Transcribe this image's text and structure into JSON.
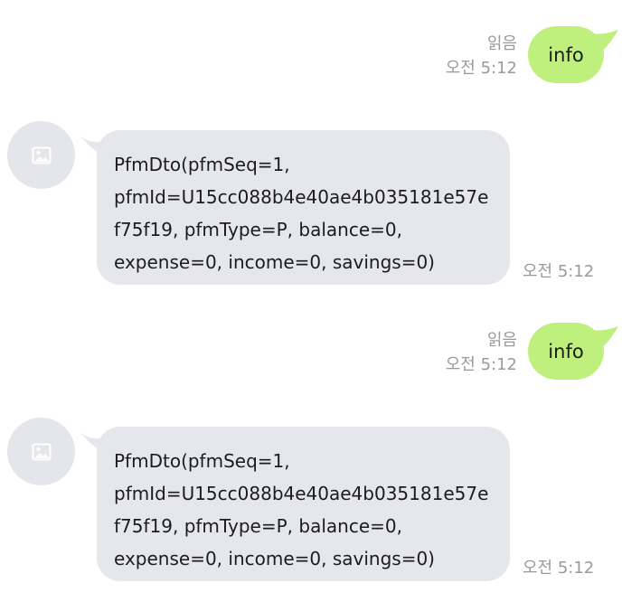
{
  "colors": {
    "sent_bubble": "#bff07d",
    "received_bubble": "#e5e7eb",
    "meta_text": "#9a9a9a"
  },
  "messages": [
    {
      "direction": "outgoing",
      "text": "info",
      "read_label": "읽음",
      "time": "오전 5:12"
    },
    {
      "direction": "incoming",
      "avatar_icon": "image-placeholder-icon",
      "lines": [
        "PfmDto(pfmSeq=1,",
        "pfmId=U15cc088b4e40ae4b035181e57e",
        "f75f19, pfmType=P, balance=0,",
        "expense=0, income=0, savings=0)"
      ],
      "time": "오전 5:12"
    },
    {
      "direction": "outgoing",
      "text": "info",
      "read_label": "읽음",
      "time": "오전 5:12"
    },
    {
      "direction": "incoming",
      "avatar_icon": "image-placeholder-icon",
      "lines": [
        "PfmDto(pfmSeq=1,",
        "pfmId=U15cc088b4e40ae4b035181e57e",
        "f75f19, pfmType=P, balance=0,",
        "expense=0, income=0, savings=0)"
      ],
      "time": "오전 5:12"
    }
  ]
}
